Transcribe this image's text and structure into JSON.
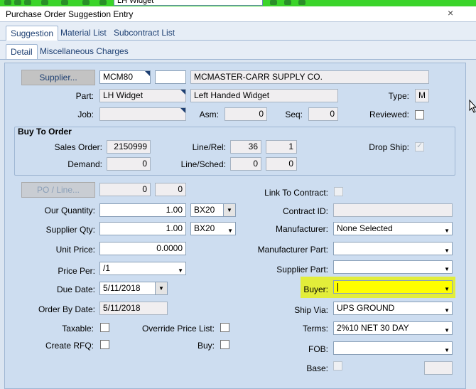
{
  "toolbar": {
    "field_value": "LH Widget"
  },
  "window": {
    "title": "Purchase Order Suggestion Entry",
    "close": "×"
  },
  "tabs_top": [
    {
      "label": "Suggestion",
      "active": true
    },
    {
      "label": "Material List",
      "active": false
    },
    {
      "label": "Subcontract List",
      "active": false
    }
  ],
  "tabs_sub": [
    {
      "label": "Detail",
      "active": true
    },
    {
      "label": "Miscellaneous Charges",
      "active": false
    }
  ],
  "supplier": {
    "button": "Supplier...",
    "id": "MCM80",
    "extra": "",
    "name": "MCMASTER-CARR SUPPLY CO."
  },
  "part": {
    "label": "Part:",
    "value": "LH Widget",
    "description": "Left Handed Widget"
  },
  "type": {
    "label": "Type:",
    "value": "M"
  },
  "job": {
    "label": "Job:",
    "value": ""
  },
  "asm": {
    "label": "Asm:",
    "value": "0"
  },
  "seq": {
    "label": "Seq:",
    "value": "0"
  },
  "reviewed": {
    "label": "Reviewed:"
  },
  "buy_to_order": {
    "title": "Buy To Order",
    "sales_order_label": "Sales Order:",
    "sales_order": "2150999",
    "line_rel_label": "Line/Rel:",
    "line": "36",
    "rel": "1",
    "drop_ship_label": "Drop Ship:",
    "demand_label": "Demand:",
    "demand": "0",
    "line_sched_label": "Line/Sched:",
    "sched_line": "0",
    "sched": "0"
  },
  "po_line": {
    "button": "PO / Line...",
    "po": "0",
    "line": "0"
  },
  "link_to_contract": {
    "label": "Link To Contract:"
  },
  "contract_id": {
    "label": "Contract ID:",
    "value": ""
  },
  "our_quantity": {
    "label": "Our Quantity:",
    "value": "1.00",
    "uom": "BX20"
  },
  "supplier_qty": {
    "label": "Supplier Qty:",
    "value": "1.00",
    "uom": "BX20"
  },
  "manufacturer": {
    "label": "Manufacturer:",
    "value": "None Selected"
  },
  "unit_price": {
    "label": "Unit Price:",
    "value": "0.0000"
  },
  "manufacturer_part": {
    "label": "Manufacturer Part:",
    "value": ""
  },
  "price_per": {
    "label": "Price Per:",
    "value": "/1"
  },
  "supplier_part": {
    "label": "Supplier Part:",
    "value": ""
  },
  "due_date": {
    "label": "Due Date:",
    "value": "5/11/2018"
  },
  "buyer": {
    "label": "Buyer:",
    "value": ""
  },
  "order_by_date": {
    "label": "Order By Date:",
    "value": "5/11/2018"
  },
  "ship_via": {
    "label": "Ship Via:",
    "value": "UPS GROUND"
  },
  "taxable": {
    "label": "Taxable:"
  },
  "override_price_list": {
    "label": "Override Price List:"
  },
  "terms": {
    "label": "Terms:",
    "value": "2%10 NET 30 DAY"
  },
  "create_rfq": {
    "label": "Create RFQ:"
  },
  "buy": {
    "label": "Buy:"
  },
  "fob": {
    "label": "FOB:",
    "value": ""
  },
  "base": {
    "label": "Base:",
    "value": ""
  },
  "colors": {
    "buyer_highlight": "#e2ed3a",
    "buyer_field": "#ffff00",
    "panel": "#cdddf0"
  }
}
